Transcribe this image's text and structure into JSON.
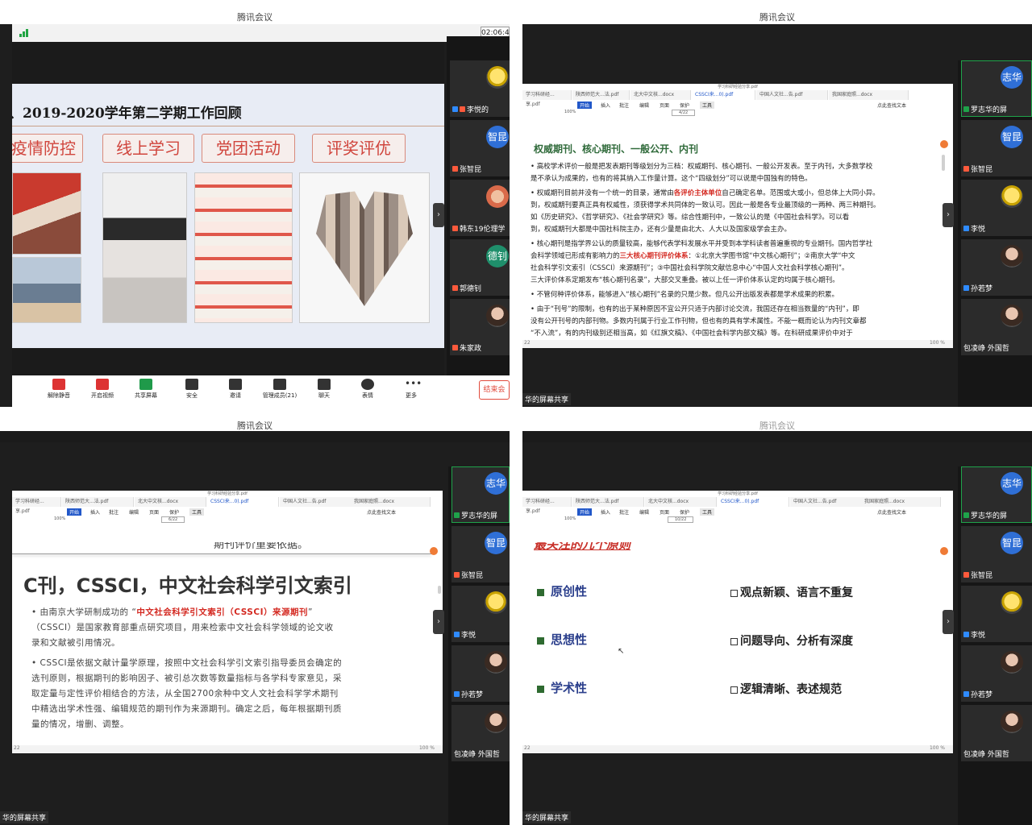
{
  "app_title": "腾讯会议",
  "quad1": {
    "timer": "02:06:4",
    "slide_title": "、2019-2020学年第二学期工作回顾",
    "categories": [
      "疫情防控",
      "线上学习",
      "党团活动",
      "评奖评优"
    ],
    "bottom_bar": [
      "解除静音",
      "开启视频",
      "共享屏幕",
      "安全",
      "邀请",
      "管理成员(21)",
      "聊天",
      "表情",
      "更多"
    ],
    "end_button": "结束会",
    "participants": [
      "李悦的",
      "张智昆",
      "韩东19伦理学",
      "郭德钊",
      "朱家政"
    ],
    "avatar_texts": [
      "智昆",
      "德钊"
    ]
  },
  "doc_common": {
    "file_title": "学习科研经验分享.pdf",
    "tabs": [
      "学习科研经...享.pdf",
      "陕西师范大...法.pdf",
      "北大中文核...docx",
      "CSSCI来...0).pdf",
      "中国人文社...告.pdf",
      "我国家庭照...docx"
    ],
    "ribbon": [
      "开始",
      "插入",
      "批注",
      "编辑",
      "页面",
      "保护",
      "工具"
    ],
    "search_text": "点此查找文本",
    "zoom": "100%",
    "status_zoom": "100 %",
    "shared_label": "华的屏幕共享"
  },
  "quad2": {
    "page": "4/22",
    "heading": "权威期刊、核心期刊、一般公开、内刊",
    "paragraphs": [
      "• 高校学术评价一般是把发表期刊等级划分为三档：权威期刊、核心期刊、一般公开发表。至于内刊，大多数学校",
      "   是不承认为成果的，也有的将其纳入工作量计算。这个“四级划分”可以说是中国独有的特色。",
      "• 权威期刊目前并没有一个统一的目录，通常由",
      "各评价主体单位",
      "自己确定名单。范围或大或小，但总体上大同小异。",
      "   到，权威期刊要真正具有权威性，须获得学术共同体的一致认可。因此一般是各专业最顶级的一两种、两三种期刊。",
      "   如《历史研究》、《哲学研究》、《社会学研究》等。综合性期刊中，一致公认的是《中国社会科学》。可以看",
      "   到，权威期刊大都是中国社科院主办，还有少量是由北大、人大以及国家级学会主办。",
      "• 核心期刊是指学界公认的质量较高，能够代表学科发展水平并受到本学科读者普遍重视的专业期刊。国内哲学社",
      "   会科学领域已形成有影响力的",
      "三大核心期刊评价体系",
      "：①北京大学图书馆“中文核心期刊”；②南京大学“中文",
      "   社会科学引文索引（CSSCI）来源期刊”；③中国社会科学院文献信息中心“中国人文社会科学核心期刊”。",
      "   三大评价体系定期发布“核心期刊名录”，大部交叉重叠。被以上任一评价体系认定的均属于核心期刊。",
      "• 不管何种评价体系，能够进入“核心期刊”名录的只是少数。但凡公开出版发表都是学术成果的积累。",
      "• 由于“刊号”的限制，也有的出于某种原因不宜公开只适于内部讨论交流，我国还存在相当数量的“内刊”，即",
      "   没有公开刊号的内部刊物。多数内刊属于行业工作刊物，但也有的具有学术属性。不能一概而论认为内刊文章都",
      "   “不入流”，有的内刊级别还相当高，如《红旗文稿》、《中国社会科学内部文稿》等。在科研成果评价中对于"
    ],
    "participants": [
      "罗志华的屏",
      "张智昆",
      "李悦",
      "孙若梦",
      "包凌峥 外国哲"
    ],
    "avatar_texts": [
      "志华",
      "智昆"
    ],
    "page_field": "22"
  },
  "quad3": {
    "page": "6/22",
    "top_fragment": "期刊评价重要依据。",
    "heading": "C刊，CSSCI，中文社会科学引文索引",
    "bullets": [
      "• 由南京大学研制成功的 “",
      "中文社会科学引文索引（CSSCI）来源期刊",
      "”",
      "   （CSSCI）是国家教育部重点研究项目，用来检索中文社会科学领域的论文收",
      "   录和文献被引用情况。",
      "• CSSCI是依据文献计量学原理，按照中文社会科学引文索引指导委员会确定的",
      "   选刊原则，根据期刊的影响因子、被引总次数等数量指标与各学科专家意见，采",
      "   取定量与定性评价相结合的方法，从全国2700余种中文人文社会科学学术期刊",
      "   中精选出学术性强、编辑规范的期刊作为来源期刊。确定之后，每年根据期刊质",
      "   量的情况，增删、调整。"
    ],
    "participants": [
      "罗志华的屏",
      "张智昆",
      "李悦",
      "孙若梦",
      "包凌峥 外国哲"
    ],
    "avatar_texts": [
      "志华",
      "智昆"
    ],
    "page_field": "22"
  },
  "quad4": {
    "page": "10/22",
    "top_fragment": "最关注的几个原则",
    "left_items": [
      "原创性",
      "思想性",
      "学术性"
    ],
    "right_items": [
      "观点新颖、语言不重复",
      "问题导向、分析有深度",
      "逻辑清晰、表述规范"
    ],
    "participants": [
      "罗志华的屏",
      "张智昆",
      "李悦",
      "孙若梦",
      "包凌峥 外国哲"
    ],
    "avatar_texts": [
      "志华",
      "智昆"
    ],
    "page_field": "22"
  }
}
